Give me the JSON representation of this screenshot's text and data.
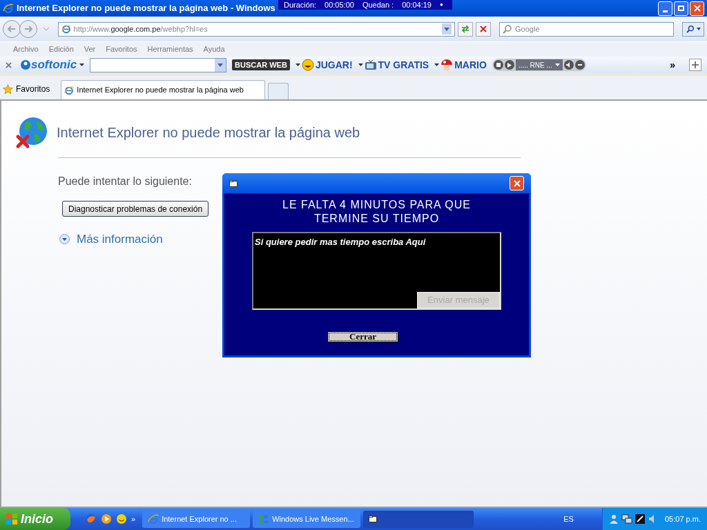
{
  "window": {
    "title": "Internet Explorer no puede mostrar la página web - Windows"
  },
  "timer": {
    "duration_label": "Duración:",
    "duration": "00:05:00",
    "remaining_label": "Quedan :",
    "remaining": "00:04:19",
    "dot": "●"
  },
  "address_bar": {
    "url_prefix": "http://www.",
    "url_domain": "google.com.pe",
    "url_suffix": "/webhp?hl=es",
    "search_placeholder": "Google"
  },
  "menu": [
    "Archivo",
    "Edición",
    "Ver",
    "Favoritos",
    "Herramientas",
    "Ayuda"
  ],
  "toolbar": {
    "brand": "softonic",
    "items": [
      {
        "kind": "button",
        "label": "BUSCAR WEB"
      },
      {
        "kind": "game",
        "label": "JUGAR!"
      },
      {
        "kind": "television",
        "label": "TV GRATIS"
      },
      {
        "kind": "mushroom",
        "label": "MARIO"
      }
    ],
    "radio": "..... RNE ...",
    "more": "»"
  },
  "favorites": {
    "label": "Favoritos"
  },
  "tabs": [
    {
      "label": "Internet Explorer no puede mostrar la página web",
      "selected": true
    }
  ],
  "page": {
    "heading": "Internet Explorer no puede mostrar la página web",
    "try_label": "Puede intentar lo siguiente:",
    "diagnose_button": "Diagnosticar problemas de conexión",
    "more_info": "Más información"
  },
  "dialog": {
    "message": "LE FALTA 4 MINUTOS PARA QUE TERMINE SU TIEMPO",
    "field_value": "Si quiere pedir mas tiempo escriba Aqui",
    "send_button": "Enviar mensaje",
    "send_disabled": true,
    "close_button": "Cerrar"
  },
  "taskbar": {
    "start": "Inicio",
    "quick_more": "»",
    "tasks": [
      {
        "kind": "browser",
        "label": "Internet Explorer no ...",
        "selected": false
      },
      {
        "kind": "messenger",
        "label": "Windows Live Messen...",
        "selected": false
      },
      {
        "kind": "window",
        "selected": true
      }
    ],
    "language": "ES",
    "clock": "05:07 p.m."
  }
}
